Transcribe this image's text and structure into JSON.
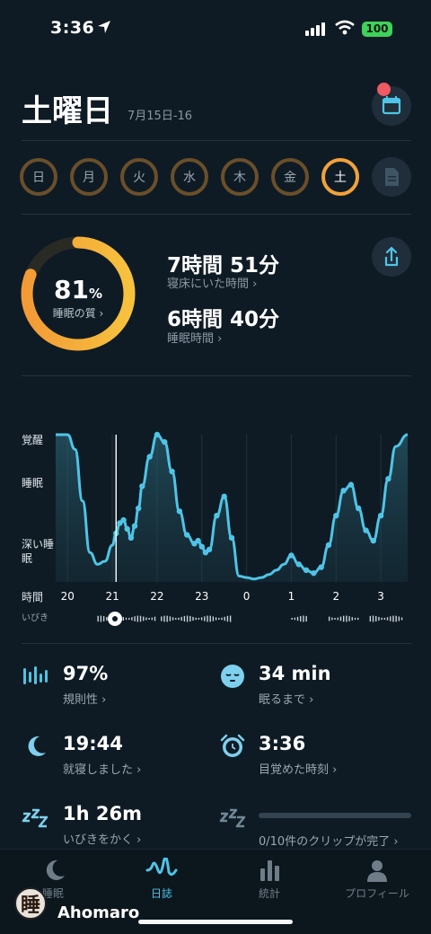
{
  "status_bar": {
    "time": "3:36",
    "battery": "100"
  },
  "header": {
    "day": "土曜日",
    "date_range": "7月15日-16"
  },
  "week": {
    "days": [
      {
        "label": "日"
      },
      {
        "label": "月"
      },
      {
        "label": "火"
      },
      {
        "label": "水"
      },
      {
        "label": "木"
      },
      {
        "label": "金"
      },
      {
        "label": "土"
      }
    ]
  },
  "score": {
    "value": "81",
    "unit": "%",
    "label": "睡眠の質 ›",
    "fraction": 0.81,
    "time_in_bed": "7時間 51分",
    "time_in_bed_label": "寝床にいた時間 ›",
    "time_asleep": "6時間 40分",
    "time_asleep_label": "睡眠時間 ›"
  },
  "chart_data": {
    "type": "line",
    "y_levels": [
      "覚醒",
      "睡眠",
      "深い睡眠"
    ],
    "x_label": "時間",
    "snore_label": "いびき",
    "x_ticks": [
      "20",
      "21",
      "22",
      "23",
      "0",
      "1",
      "2",
      "3"
    ],
    "x": [
      "19:44",
      "20:00",
      "20:10",
      "20:20",
      "20:30",
      "20:40",
      "20:50",
      "21:00",
      "21:05",
      "21:10",
      "21:15",
      "21:20",
      "21:25",
      "21:30",
      "21:35",
      "21:40",
      "21:50",
      "22:00",
      "22:10",
      "22:20",
      "22:30",
      "22:40",
      "22:50",
      "22:55",
      "23:00",
      "23:05",
      "23:10",
      "23:20",
      "23:30",
      "23:40",
      "23:50",
      "0:00",
      "0:10",
      "0:20",
      "0:30",
      "0:40",
      "0:50",
      "1:00",
      "1:10",
      "1:20",
      "1:30",
      "1:40",
      "1:50",
      "2:00",
      "2:10",
      "2:20",
      "2:30",
      "2:40",
      "2:50",
      "3:00",
      "3:10",
      "3:20",
      "3:36"
    ],
    "y": [
      1.0,
      1.0,
      0.9,
      0.55,
      0.2,
      0.12,
      0.14,
      0.25,
      0.33,
      0.4,
      0.42,
      0.36,
      0.3,
      0.38,
      0.5,
      0.65,
      0.85,
      1.0,
      0.95,
      0.75,
      0.48,
      0.32,
      0.26,
      0.28,
      0.24,
      0.2,
      0.22,
      0.45,
      0.58,
      0.3,
      0.04,
      0.03,
      0.02,
      0.03,
      0.05,
      0.08,
      0.12,
      0.18,
      0.12,
      0.08,
      0.06,
      0.1,
      0.25,
      0.45,
      0.62,
      0.66,
      0.5,
      0.35,
      0.28,
      0.45,
      0.7,
      0.92,
      1.0
    ],
    "ylim": [
      0,
      1
    ],
    "grid": true
  },
  "metrics": {
    "regularity": {
      "value": "97%",
      "label": "規則性 ›"
    },
    "fall_asleep": {
      "value": "34 min",
      "label": "眠るまで ›"
    },
    "bedtime": {
      "value": "19:44",
      "label": "就寝しました ›"
    },
    "wake": {
      "value": "3:36",
      "label": "目覚めた時刻 ›"
    },
    "snoring": {
      "value": "1h 26m",
      "label": "いびきをかく ›"
    },
    "clips": {
      "label": "0/10件のクリップが完了 ›",
      "progress": 0
    }
  },
  "tabs": [
    {
      "label": "睡眠"
    },
    {
      "label": "日誌"
    },
    {
      "label": "統計"
    },
    {
      "label": "プロフィール"
    }
  ],
  "watermark": {
    "text": "Ahomaro"
  },
  "colors": {
    "accent": "#4fc4e6",
    "ring": "#f0a23b",
    "bg": "#0f1b24"
  }
}
